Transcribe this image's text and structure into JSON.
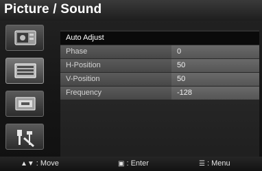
{
  "header": {
    "title": "Picture / Sound"
  },
  "sidebar": {
    "items": [
      {
        "icon": "picture-icon",
        "active": false
      },
      {
        "icon": "pc-settings-icon",
        "active": true
      },
      {
        "icon": "aspect-ratio-icon",
        "active": false
      },
      {
        "icon": "tools-icon",
        "active": false
      }
    ]
  },
  "menu": {
    "heading": "Auto Adjust",
    "items": [
      {
        "label": "Phase",
        "value": "0"
      },
      {
        "label": "H-Position",
        "value": "50"
      },
      {
        "label": "V-Position",
        "value": "50"
      },
      {
        "label": "Frequency",
        "value": "-128"
      }
    ]
  },
  "footer": {
    "move_icon": "▲▼",
    "move_label": ": Move",
    "enter_icon": "▣",
    "enter_label": ": Enter",
    "menu_icon": "☰",
    "menu_label": ": Menu"
  }
}
